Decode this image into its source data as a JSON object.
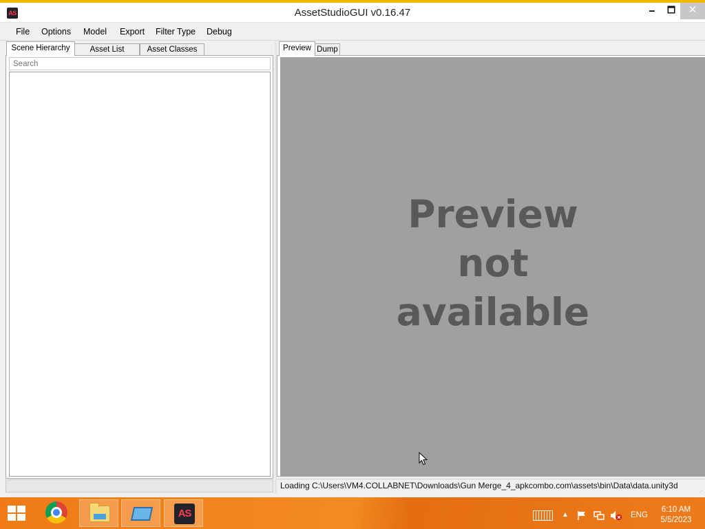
{
  "window": {
    "title": "AssetStudioGUI v0.16.47",
    "icon_text": "AS",
    "min_glyph": "🗕",
    "max_glyph": "🗖",
    "close_glyph": "✕"
  },
  "menu": [
    "File",
    "Options",
    "Model",
    "Export",
    "Filter Type",
    "Debug"
  ],
  "left_tabs": [
    "Scene Hierarchy",
    "Asset List",
    "Asset Classes"
  ],
  "search": {
    "placeholder": "Search",
    "value": ""
  },
  "right_tabs": [
    "Preview",
    "Dump"
  ],
  "preview": {
    "message_lines": [
      "Preview",
      "not",
      "available"
    ]
  },
  "status": {
    "text": "Loading C:\\Users\\VM4.COLLABNET\\Downloads\\Gun Merge_4_apkcombo.com\\assets\\bin\\Data\\data.unity3d"
  },
  "taskbar": {
    "pinned": [
      "start-icon",
      "chrome-icon",
      "file-explorer-icon",
      "remote-desktop-icon",
      "assetstudio-icon"
    ],
    "as_icon_text": "AS",
    "language": "ENG",
    "time": "6:10 AM",
    "date": "5/5/2023",
    "tray_chevron": "▲"
  },
  "colors": {
    "accent_stripe": "#f2b800",
    "taskbar": "#f07b16",
    "preview_bg": "#a0a0a0",
    "preview_text": "#595959"
  }
}
